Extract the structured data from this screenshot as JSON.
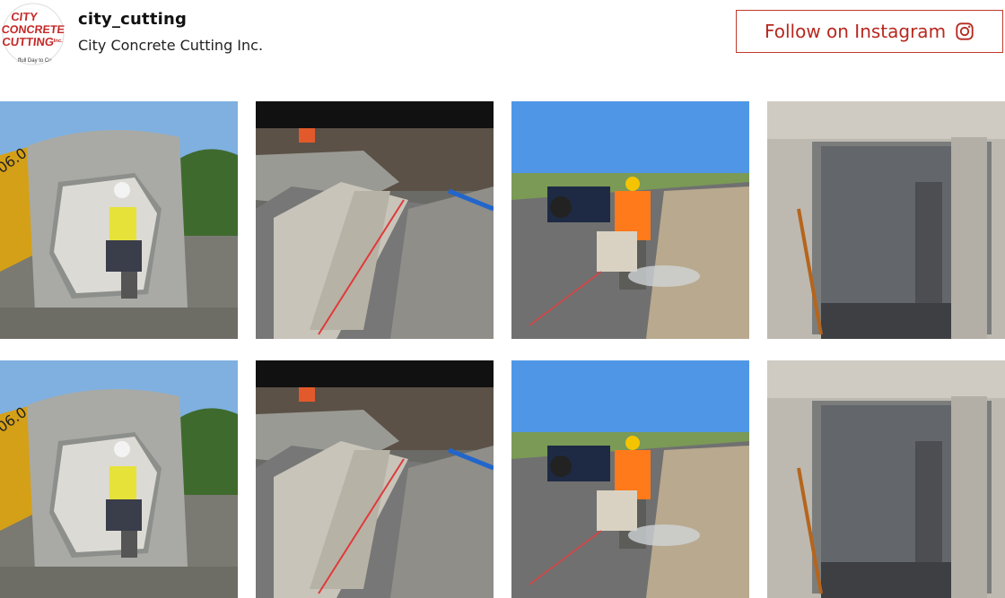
{
  "profile": {
    "username": "city_cutting",
    "full_name": "City Concrete Cutting Inc.",
    "avatar": {
      "logo_line1": "CITY",
      "logo_line2": "CONCRETE",
      "logo_line3": "CUTTING",
      "logo_suffix": "Inc.",
      "tagline": "...ffull Day to Cu..."
    }
  },
  "follow_button": {
    "label": "Follow on Instagram",
    "icon": "instagram-icon"
  },
  "colors": {
    "brand_red": "#b7281f",
    "border_red": "#c0392b"
  },
  "posts": [
    {
      "id": "post-1",
      "scene": "worker-in-concrete-culvert"
    },
    {
      "id": "post-2",
      "scene": "cut-concrete-trench"
    },
    {
      "id": "post-3",
      "scene": "road-saw-cutting"
    },
    {
      "id": "post-4",
      "scene": "elevator-opening-cut"
    },
    {
      "id": "post-5",
      "scene": "worker-in-concrete-culvert"
    },
    {
      "id": "post-6",
      "scene": "cut-concrete-trench"
    },
    {
      "id": "post-7",
      "scene": "road-saw-cutting"
    },
    {
      "id": "post-8",
      "scene": "elevator-opening-cut"
    }
  ]
}
